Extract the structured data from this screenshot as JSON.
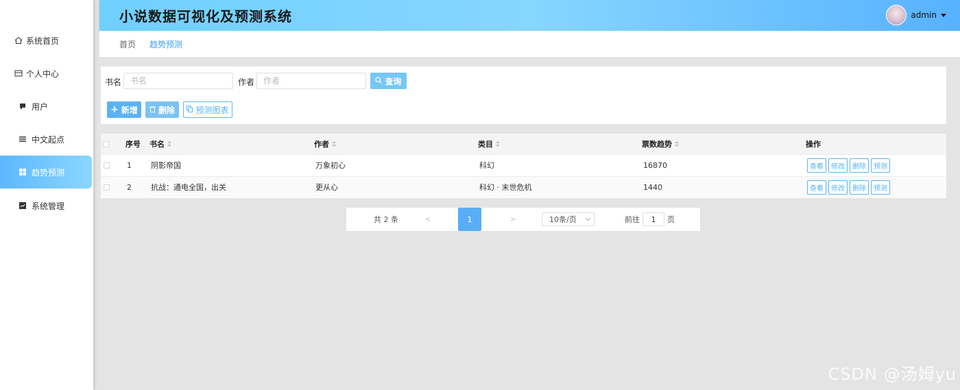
{
  "app": {
    "title": "小说数据可视化及预测系统",
    "user": "admin"
  },
  "sidebar": {
    "items": [
      {
        "label": "系统首页",
        "icon": "home-icon"
      },
      {
        "label": "个人中心",
        "icon": "card-icon"
      },
      {
        "label": "用户",
        "icon": "user-icon"
      },
      {
        "label": "中文起点",
        "icon": "menu-icon"
      },
      {
        "label": "趋势预测",
        "icon": "grid-icon",
        "active": true
      },
      {
        "label": "系统管理",
        "icon": "chart-icon"
      }
    ]
  },
  "breadcrumb": {
    "items": [
      "首页",
      "趋势预测"
    ]
  },
  "search": {
    "book_label": "书名",
    "book_placeholder": "书名",
    "author_label": "作者",
    "author_placeholder": "作者",
    "query_button": "查询"
  },
  "toolbar": {
    "add": "新增",
    "delete": "删除",
    "predict_chart": "预测图表"
  },
  "table": {
    "columns": [
      "序号",
      "书名",
      "作者",
      "类目",
      "票数趋势",
      "操作"
    ],
    "rows": [
      {
        "index": "1",
        "book": "阴影帝国",
        "author": "万象初心",
        "category": "科幻",
        "votes": "16870"
      },
      {
        "index": "2",
        "book": "抗战：通电全国，出关",
        "author": "更从心",
        "category": "科幻 · 末世危机",
        "votes": "1440"
      }
    ],
    "row_actions": [
      "查看",
      "修改",
      "删除",
      "预测"
    ]
  },
  "pagination": {
    "total": "共 2 条",
    "prev": "<",
    "current": "1",
    "next": ">",
    "page_size": "10条/页",
    "goto_label": "前往",
    "goto_value": "1",
    "page_unit": "页"
  },
  "watermark": "CSDN @汤姆yu",
  "colors": {
    "primary": "#5ab3f5",
    "header_start": "#6fd0ff",
    "header_end": "#57b2ff"
  }
}
